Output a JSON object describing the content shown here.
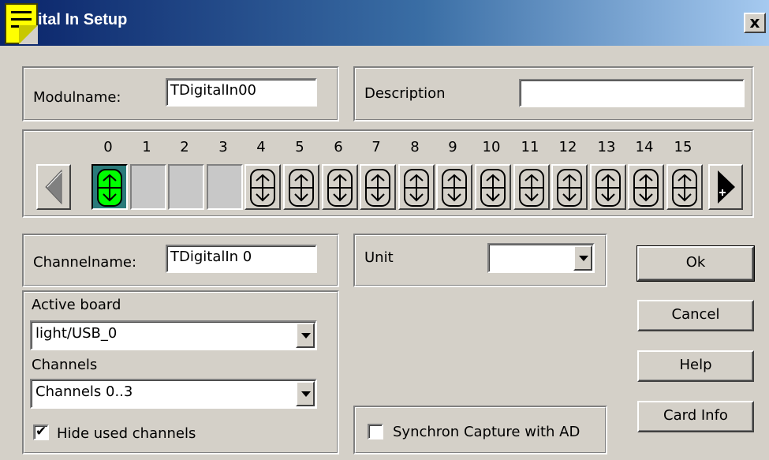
{
  "window": {
    "title": "ital In Setup",
    "close_label": "x"
  },
  "module": {
    "name_label": "Modulname:",
    "name_value": "TDigitalIn00"
  },
  "description": {
    "label": "Description",
    "value": ""
  },
  "channels_strip": {
    "numbers": [
      "0",
      "1",
      "2",
      "3",
      "4",
      "5",
      "6",
      "7",
      "8",
      "9",
      "10",
      "11",
      "12",
      "13",
      "14",
      "15"
    ],
    "states": [
      "selected",
      "empty",
      "empty",
      "empty",
      "plug",
      "plug",
      "plug",
      "plug",
      "plug",
      "plug",
      "plug",
      "plug",
      "plug",
      "plug",
      "plug",
      "plug"
    ]
  },
  "channel": {
    "name_label": "Channelname:",
    "name_value": "TDigitalIn 0"
  },
  "unit": {
    "label": "Unit",
    "value": ""
  },
  "board": {
    "active_label": "Active board",
    "active_value": "light/USB_0",
    "channels_label": "Channels",
    "channels_value": "Channels 0..3",
    "hide_used_label": "Hide used channels",
    "hide_used_checked": true
  },
  "sync": {
    "label": "Synchron Capture with AD",
    "checked": false
  },
  "buttons": {
    "ok": "Ok",
    "cancel": "Cancel",
    "help": "Help",
    "card_info": "Card Info"
  },
  "colors": {
    "title_start": "#0a246a",
    "title_end": "#a6caf0",
    "face": "#d4d0c8",
    "selected_channel": "#2a7a7a"
  },
  "icons": {
    "app": "note-icon",
    "prev": "arrow-left-icon",
    "next": "arrow-right-plus-icon",
    "channel": "plug-icon"
  }
}
